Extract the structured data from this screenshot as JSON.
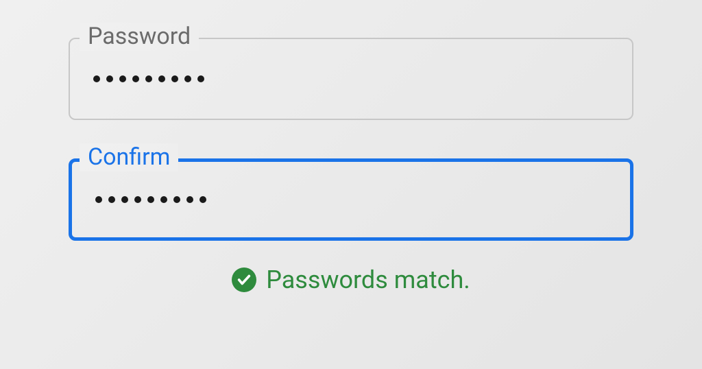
{
  "password_field": {
    "label": "Password",
    "masked_value": "•••••••••",
    "dot_count": 9
  },
  "confirm_field": {
    "label": "Confirm",
    "masked_value": "•••••••••",
    "dot_count": 9
  },
  "validation": {
    "message": "Passwords match.",
    "status": "success",
    "icon": "check-circle-icon"
  },
  "colors": {
    "active_border": "#1a73e8",
    "inactive_border": "#c7c7c7",
    "success": "#2e8b3d",
    "label_inactive": "#6b6b6b"
  }
}
